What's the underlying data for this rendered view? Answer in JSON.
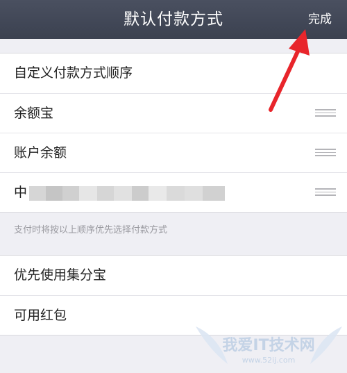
{
  "navbar": {
    "title": "默认付款方式",
    "done_label": "完成"
  },
  "order_group": {
    "header_label": "自定义付款方式顺序",
    "items": [
      {
        "label": "余额宝"
      },
      {
        "label": "账户余额"
      },
      {
        "label": "中"
      }
    ]
  },
  "hint": "支付时将按以上顺序优先选择付款方式",
  "bottom_group": {
    "items": [
      {
        "label": "优先使用集分宝"
      },
      {
        "label": "可用红包"
      }
    ]
  },
  "watermark": {
    "text": "我爱IT技术网",
    "url": "www.52ij.com"
  },
  "colors": {
    "navbar": "#3b4150",
    "background": "#efeff4",
    "annotation_arrow": "#e8252b"
  }
}
